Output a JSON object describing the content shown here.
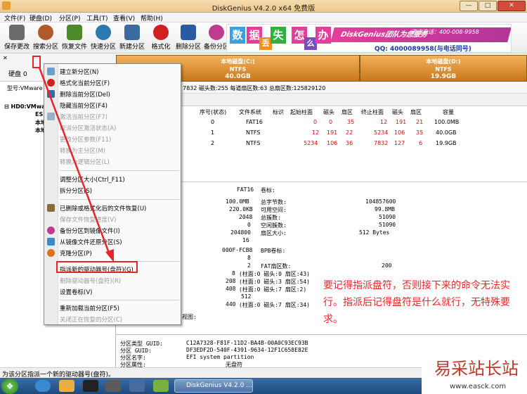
{
  "window": {
    "title": "DiskGenius V4.2.0 x64 免费版",
    "buttons": {
      "minimize": "—",
      "maximize": "□",
      "close": "✕"
    }
  },
  "menu": [
    "文件(F)",
    "硬盘(D)",
    "分区(P)",
    "工具(T)",
    "查看(V)",
    "帮助(H)"
  ],
  "toolbar": [
    {
      "label": "保存更改",
      "icon": "save-icon",
      "color": "#6b6b6b"
    },
    {
      "label": "搜索分区",
      "icon": "search-magnifier-icon",
      "color": "#b05a2a"
    },
    {
      "label": "恢复文件",
      "icon": "recover-files-icon",
      "color": "#4a8a2a"
    },
    {
      "label": "快速分区",
      "icon": "quick-partition-icon",
      "color": "#2a7ab0"
    },
    {
      "label": "新建分区",
      "icon": "new-partition-icon",
      "color": "#3a6aa0"
    },
    {
      "label": "格式化",
      "icon": "format-icon",
      "color": "#d02020"
    },
    {
      "label": "删除分区",
      "icon": "delete-partition-icon",
      "color": "#2a5aa0"
    },
    {
      "label": "备份分区",
      "icon": "backup-partition-icon",
      "color": "#c03a90"
    }
  ],
  "ad": {
    "chars": [
      "数",
      "据",
      "丢",
      "失",
      "怎",
      "么",
      "办"
    ],
    "band": "DiskGenius团队为您服务",
    "phone": "咨询电话：400-008-9958",
    "qq": "QQ: 4000089958(与电话同号)",
    "colors": [
      "#3aa0e0",
      "#e43e9a",
      "#f09020",
      "#30b040",
      "#e43e9a",
      "#7a4ac0",
      "#e43e9a"
    ]
  },
  "disk_strip": {
    "label": "硬盘 0",
    "model": "型号:VMware"
  },
  "partitions": [
    {
      "name": "本地磁盘(C:)",
      "fs": "NTFS",
      "size": "40.0GB"
    },
    {
      "name": "本地磁盘(D:)",
      "fs": "NTFS",
      "size": "19.9GB"
    }
  ],
  "disk_info": "7832  磁头数:255  每道扇区数:63  总扇区数:125829120",
  "tree": {
    "root": "HD0:VMware",
    "items": [
      "ESP",
      "本地",
      "本地"
    ]
  },
  "table": {
    "headers": [
      "序号(状态)",
      "文件系统",
      "标识",
      "起始柱面",
      "磁头",
      "扇区",
      "终止柱面",
      "磁头",
      "扇区",
      "容量"
    ],
    "rows": [
      [
        "0",
        "FAT16",
        "",
        "0",
        "0",
        "35",
        "12",
        "191",
        "21",
        "100.0MB"
      ],
      [
        "1",
        "NTFS",
        "",
        "12",
        "191",
        "22",
        "5234",
        "106",
        "35",
        "40.0GB"
      ],
      [
        "2",
        "NTFS",
        "",
        "5234",
        "106",
        "36",
        "7832",
        "127",
        "6",
        "19.9GB"
      ]
    ]
  },
  "details": {
    "fs": "FAT16",
    "label_title": "卷标:",
    "left_values": [
      "100.0MB",
      "220.0KB",
      "2048",
      "0",
      "204800",
      "16"
    ],
    "right_labels": [
      "总字节数:",
      "可用空间:",
      "总簇数:",
      "空闲簇数:",
      "扇区大小:"
    ],
    "right_values": [
      "104857600",
      "99.8MB",
      "51090",
      "51090",
      "512 Bytes"
    ],
    "serial": "000F-FCB8",
    "bpb": "BPB卷标:",
    "extra": [
      "8",
      "2",
      "8",
      "208",
      "408",
      "512",
      "440"
    ],
    "fat_label": "FAT扇区数:",
    "fat_value": "200",
    "chs": [
      "(柱面:0 磁头:0 扇区:43)",
      "(柱面:0 磁头:3 扇区:54)",
      "(柱面:0 磁头:7 扇区:2)",
      "(柱面:0 磁头:7 扇区:34)"
    ],
    "view_label": "视图:",
    "guid_labels": [
      "分区类型 GUID:",
      "分区 GUID:",
      "分区名字:",
      "分区属性:"
    ],
    "guid_values": [
      "C12A7328-F81F-11D2-BA4B-00A0C93EC93B",
      "DF3EDF2D-540F-4391-9634-12F1C658E82E",
      "EFI system partition",
      "无盘符"
    ]
  },
  "context_menu": [
    {
      "label": "建立新分区(N)",
      "disabled": false,
      "icon": "#6aa0d0"
    },
    {
      "label": "格式化当前分区(F)",
      "disabled": false,
      "icon": "#d02020"
    },
    {
      "label": "删除当前分区(Del)",
      "disabled": false,
      "icon": "#3a6aa0"
    },
    {
      "label": "隐藏当前分区(F4)",
      "disabled": false,
      "icon": ""
    },
    {
      "label": "激活当前分区(F7)",
      "disabled": true,
      "icon": "#9ab0c8"
    },
    {
      "label": "取消分区激活状态(A)",
      "disabled": true,
      "icon": ""
    },
    {
      "label": "更改分区参数(F11)",
      "disabled": true,
      "icon": ""
    },
    {
      "label": "转换为主分区(M)",
      "disabled": true,
      "icon": ""
    },
    {
      "label": "转换为逻辑分区(L)",
      "disabled": true,
      "icon": ""
    },
    {
      "label": "调整分区大小(Ctrl_F11)",
      "disabled": false,
      "icon": ""
    },
    {
      "label": "拆分分区(S)",
      "disabled": false,
      "icon": ""
    },
    {
      "label": "已删除或格式化后的文件恢复(U)",
      "disabled": false,
      "icon": "#8a6a3a"
    },
    {
      "label": "保存文件恢复进度(V)",
      "disabled": true,
      "icon": ""
    },
    {
      "label": "备份分区到镜像文件(I)",
      "disabled": false,
      "icon": "#c03a90"
    },
    {
      "label": "从镜像文件还原分区(S)",
      "disabled": false,
      "icon": "#3a8ad0"
    },
    {
      "label": "克隆分区(P)",
      "disabled": false,
      "icon": "#e07020"
    },
    {
      "label": "指派新的驱动器号(盘符)(G)",
      "disabled": false,
      "icon": ""
    },
    {
      "label": "删除驱动器号(盘符)(R)",
      "disabled": true,
      "icon": ""
    },
    {
      "label": "设置卷标(V)",
      "disabled": false,
      "icon": ""
    },
    {
      "label": "重新加载当前分区(F5)",
      "disabled": false,
      "icon": ""
    },
    {
      "label": "关闭正在恢复的分区(C)",
      "disabled": true,
      "icon": ""
    }
  ],
  "annotation": "要记得指派盘符，否则接下来的命令无法实行。指派后记得盘符是什么就行，无特殊要求。",
  "status": "为该分区指派一个新的驱动器号(盘符)。",
  "taskbar": {
    "app": "DiskGenius V4.2.0 ..."
  },
  "watermark": {
    "text": "易采站长站",
    "url": "www.easck.com"
  }
}
